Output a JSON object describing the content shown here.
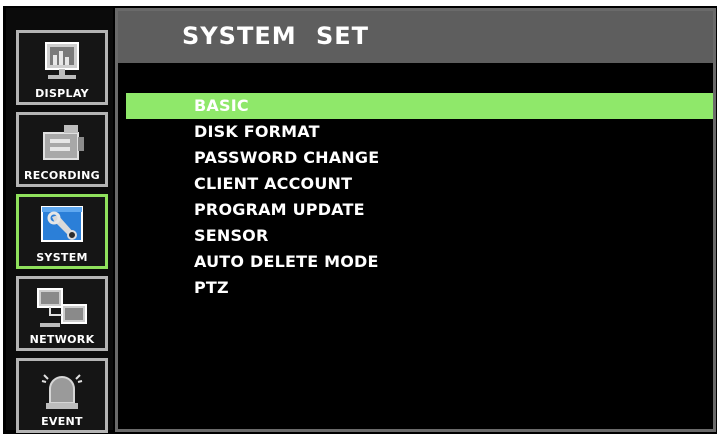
{
  "sidebar": {
    "items": [
      {
        "id": "display",
        "label": "DISPLAY",
        "icon": "monitor-chart-icon",
        "active": false
      },
      {
        "id": "recording",
        "label": "RECORDING",
        "icon": "camera-icon",
        "active": false
      },
      {
        "id": "system",
        "label": "SYSTEM",
        "icon": "wrench-screen-icon",
        "active": true
      },
      {
        "id": "network",
        "label": "NETWORK",
        "icon": "network-icon",
        "active": false
      },
      {
        "id": "event",
        "label": "EVENT",
        "icon": "alarm-light-icon",
        "active": false
      }
    ]
  },
  "panel": {
    "title": "SYSTEM SET",
    "menu": [
      {
        "label": "BASIC",
        "selected": true
      },
      {
        "label": "DISK FORMAT",
        "selected": false
      },
      {
        "label": "PASSWORD CHANGE",
        "selected": false
      },
      {
        "label": "CLIENT ACCOUNT",
        "selected": false
      },
      {
        "label": "PROGRAM UPDATE",
        "selected": false
      },
      {
        "label": "SENSOR",
        "selected": false
      },
      {
        "label": "AUTO DELETE MODE",
        "selected": false
      },
      {
        "label": "PTZ",
        "selected": false
      }
    ]
  },
  "colors": {
    "accent": "#8fe86a",
    "title_bar": "#5e5e5e",
    "background": "#000000"
  }
}
